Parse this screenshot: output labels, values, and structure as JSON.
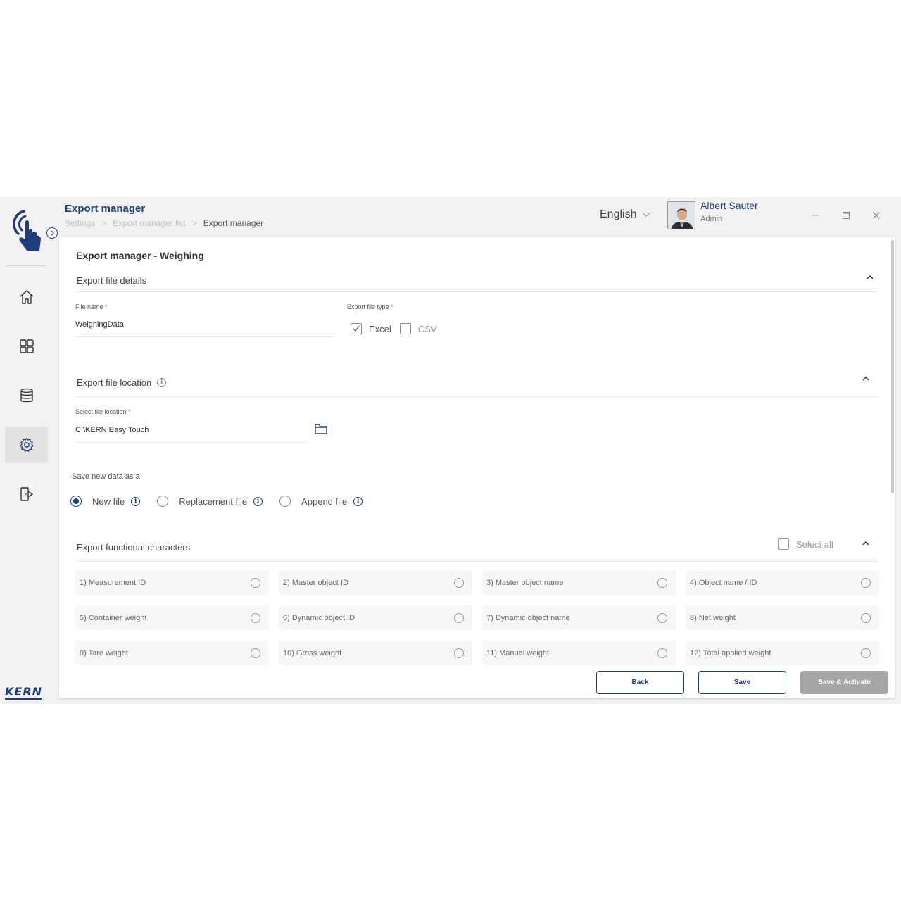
{
  "header": {
    "title": "Export manager",
    "breadcrumb": [
      "Settings",
      "Export manager list",
      "Export manager"
    ],
    "language": "English",
    "user": {
      "name": "Albert Sauter",
      "role": "Admin"
    }
  },
  "sidebar": {
    "nav": [
      "home-icon",
      "grid-icon",
      "database-icon",
      "settings-icon",
      "logout-icon"
    ],
    "active": "settings-icon",
    "brand": "KERN"
  },
  "card": {
    "title": "Export manager - Weighing",
    "file_details": {
      "heading": "Export file details",
      "file_name_label": "File name",
      "file_name_value": "WeighingData",
      "file_type_label": "Export file type",
      "types": [
        {
          "label": "Excel",
          "checked": true
        },
        {
          "label": "CSV",
          "checked": false
        }
      ]
    },
    "file_location": {
      "heading": "Export file location",
      "location_label": "Select file location",
      "location_value": "C:\\KERN Easy Touch"
    },
    "save_as": {
      "label": "Save new data as a",
      "options": [
        {
          "label": "New file",
          "selected": true
        },
        {
          "label": "Replacement file",
          "selected": false
        },
        {
          "label": "Append file",
          "selected": false
        }
      ]
    },
    "characters": {
      "heading": "Export functional characters",
      "select_all": "Select all",
      "items": [
        "1)  Measurement ID",
        "2)  Master object ID",
        "3)  Master object name",
        "4)  Object name / ID",
        "5)  Container weight",
        "6)  Dynamic object ID",
        "7)  Dynamic object name",
        "8)  Net weight",
        "9)  Tare weight",
        "10)  Gross weight",
        "11)  Manual weight",
        "12)  Total applied weight"
      ]
    },
    "buttons": {
      "back": "Back",
      "save": "Save",
      "save_activate": "Save & Activate"
    }
  },
  "colors": {
    "brand": "#1f3d7a",
    "required": "#d9534f",
    "disabled_button": "#a6a6a6"
  }
}
